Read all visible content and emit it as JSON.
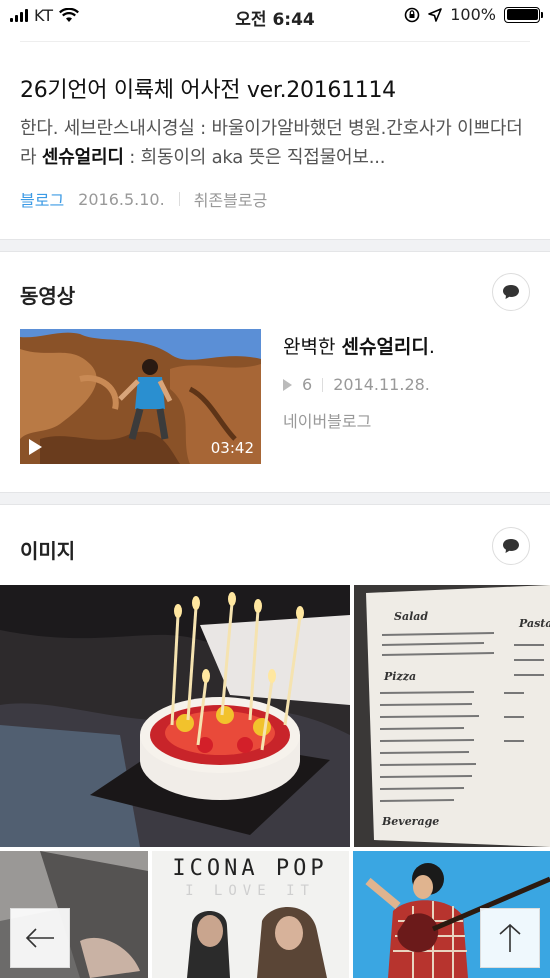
{
  "status_bar": {
    "carrier": "KT",
    "time": "오전 6:44",
    "battery": "100%"
  },
  "blog_result": {
    "title": "26기언어 이륙체 어사전 ver.20161114",
    "desc_part1": "한다. 세브란스내시경실 : 바울이가알바했던 병원.간호사가 이쁘다더라 ",
    "desc_highlight": "센슈얼리디",
    "desc_part2": " : 희동이의 aka 뜻은 직접물어보...",
    "source": "블로그",
    "date": "2016.5.10.",
    "author": "취존블로긍"
  },
  "video_section": {
    "title": "동영상",
    "video": {
      "title_prefix": "완벽한 ",
      "title_highlight": "센슈얼리디",
      "title_suffix": ".",
      "play_count": "6",
      "date": "2014.11.28.",
      "source": "네이버블로그",
      "duration": "03:42"
    }
  },
  "image_section": {
    "title": "이미지",
    "album_text": "ICONA POP",
    "album_subtext": "I LOVE IT",
    "menu_heading1": "Salad",
    "menu_heading2": "Pizza",
    "menu_heading3": "Pasta",
    "menu_footer": "Beverage"
  },
  "icons": {
    "comment": "speech-bubble-icon",
    "back": "arrow-left-icon",
    "top": "arrow-up-icon"
  },
  "colors": {
    "link_blue": "#3d9be5",
    "section_gap": "#f1f2f4"
  }
}
